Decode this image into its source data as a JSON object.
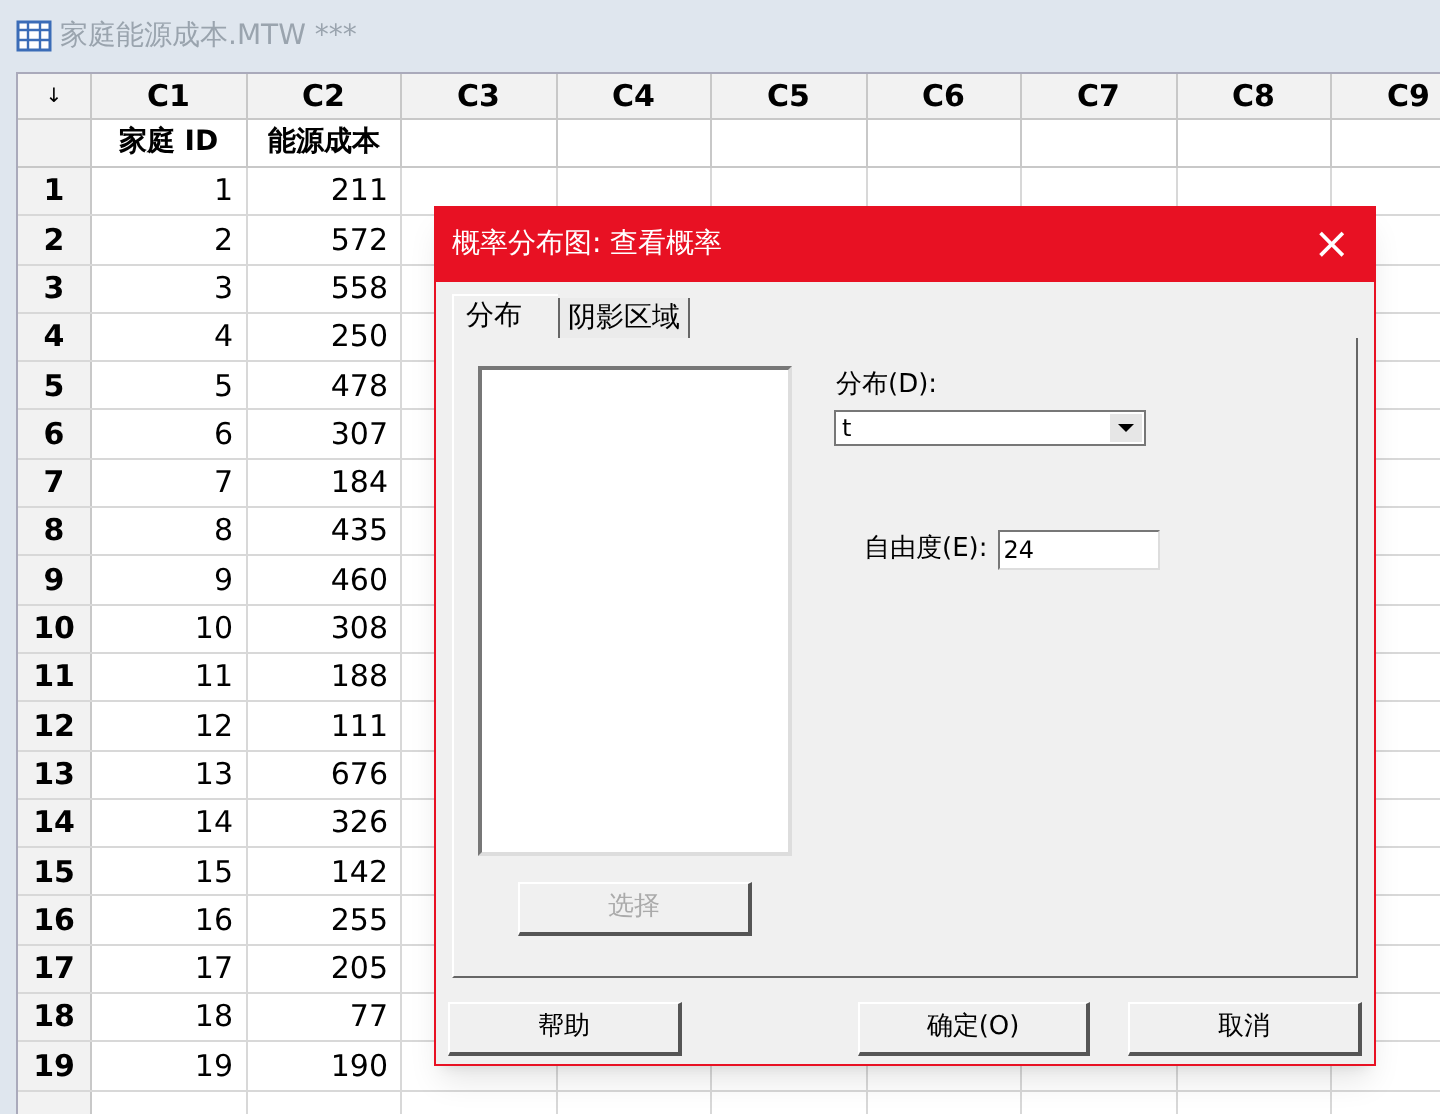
{
  "window": {
    "title": "家庭能源成本.MTW ***"
  },
  "worksheet": {
    "corner": "↓",
    "columns": [
      "C1",
      "C2",
      "C3",
      "C4",
      "C5",
      "C6",
      "C7",
      "C8",
      "C9"
    ],
    "column_names": [
      "家庭 ID",
      "能源成本"
    ],
    "rows": [
      {
        "label": "1",
        "values": [
          "1",
          "211"
        ]
      },
      {
        "label": "2",
        "values": [
          "2",
          "572"
        ]
      },
      {
        "label": "3",
        "values": [
          "3",
          "558"
        ]
      },
      {
        "label": "4",
        "values": [
          "4",
          "250"
        ]
      },
      {
        "label": "5",
        "values": [
          "5",
          "478"
        ]
      },
      {
        "label": "6",
        "values": [
          "6",
          "307"
        ]
      },
      {
        "label": "7",
        "values": [
          "7",
          "184"
        ]
      },
      {
        "label": "8",
        "values": [
          "8",
          "435"
        ]
      },
      {
        "label": "9",
        "values": [
          "9",
          "460"
        ]
      },
      {
        "label": "10",
        "values": [
          "10",
          "308"
        ]
      },
      {
        "label": "11",
        "values": [
          "11",
          "188"
        ]
      },
      {
        "label": "12",
        "values": [
          "12",
          "111"
        ]
      },
      {
        "label": "13",
        "values": [
          "13",
          "676"
        ]
      },
      {
        "label": "14",
        "values": [
          "14",
          "326"
        ]
      },
      {
        "label": "15",
        "values": [
          "15",
          "142"
        ]
      },
      {
        "label": "16",
        "values": [
          "16",
          "255"
        ]
      },
      {
        "label": "17",
        "values": [
          "17",
          "205"
        ]
      },
      {
        "label": "18",
        "values": [
          "18",
          "77"
        ]
      },
      {
        "label": "19",
        "values": [
          "19",
          "190"
        ]
      }
    ]
  },
  "dialog": {
    "title": "概率分布图: 查看概率",
    "close": "×",
    "tabs": [
      {
        "label": "分布",
        "selected": true
      },
      {
        "label": "阴影区域",
        "selected": false
      }
    ],
    "select_button": {
      "label": "选择",
      "disabled": true
    },
    "distribution": {
      "label": "分布(D):",
      "value": "t"
    },
    "degrees_of_freedom": {
      "label": "自由度(E):",
      "value": "24"
    },
    "buttons": [
      "帮助",
      "确定(O)",
      "取消"
    ]
  }
}
